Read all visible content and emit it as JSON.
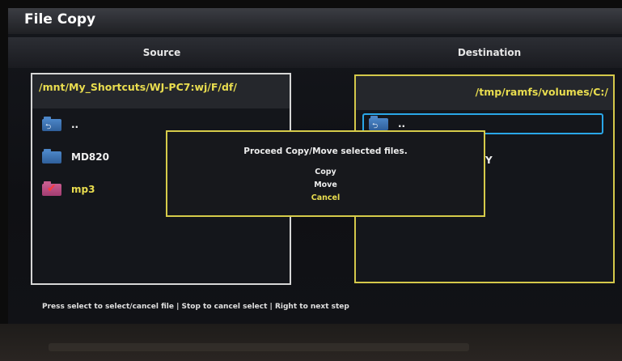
{
  "window": {
    "title": "File Copy"
  },
  "source": {
    "header": "Source",
    "path": "/mnt/My_Shortcuts/WJ-PC7:wj/F/df/",
    "items": [
      {
        "label": "..",
        "icon": "folder-up-icon"
      },
      {
        "label": "MD820",
        "icon": "folder-icon"
      },
      {
        "label": "mp3",
        "icon": "folder-checked-icon"
      }
    ]
  },
  "destination": {
    "header": "Destination",
    "path": "/tmp/ramfs/volumes/C:/",
    "selected_item": "..",
    "partial_item": "Y"
  },
  "dialog": {
    "message": "Proceed Copy/Move selected files.",
    "options": [
      "Copy",
      "Move",
      "Cancel"
    ]
  },
  "footer": {
    "hint": "Press select to select/cancel file | Stop to cancel select | Right to next step"
  },
  "colors": {
    "accent_yellow": "#e9dd4f",
    "focus_blue": "#2aa7e8",
    "folder_blue": "#4c86c8",
    "checked_pink": "#c85c8e"
  }
}
